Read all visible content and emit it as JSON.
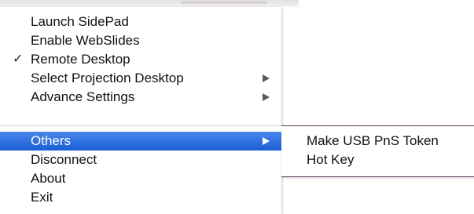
{
  "menu": {
    "items": [
      {
        "label": "Launch SidePad",
        "checked": false,
        "has_submenu": false
      },
      {
        "label": "Enable WebSlides",
        "checked": false,
        "has_submenu": false
      },
      {
        "label": "Remote Desktop",
        "checked": true,
        "check_glyph": "✓",
        "has_submenu": false
      },
      {
        "label": "Select Projection Desktop",
        "checked": false,
        "has_submenu": true,
        "arrow_icon": "triangle-right-icon"
      },
      {
        "label": "Advance Settings",
        "checked": false,
        "has_submenu": true,
        "arrow_icon": "triangle-right-icon"
      },
      {
        "label": "Others",
        "checked": false,
        "has_submenu": true,
        "selected": true,
        "arrow_icon": "triangle-right-icon"
      },
      {
        "label": "Disconnect",
        "checked": false,
        "has_submenu": false
      },
      {
        "label": "About",
        "checked": false,
        "has_submenu": false
      },
      {
        "label": "Exit",
        "checked": false,
        "has_submenu": false
      }
    ]
  },
  "submenu": {
    "parent": "Others",
    "items": [
      {
        "label": "Make USB PnS Token"
      },
      {
        "label": "Hot Key"
      }
    ]
  },
  "colors": {
    "selection_top": "#4a86ea",
    "selection_bottom": "#1a5fd6",
    "submenu_border": "#5e3a63",
    "text": "#111111"
  }
}
